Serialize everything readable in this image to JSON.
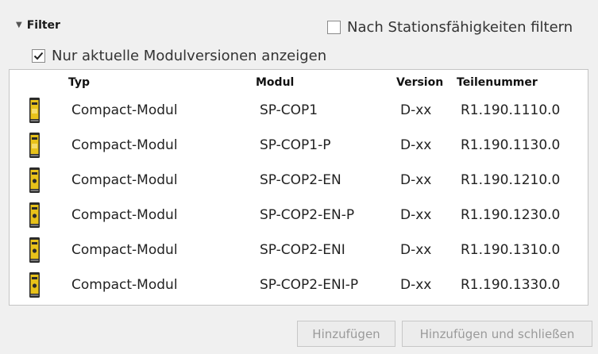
{
  "filter": {
    "label": "Filter",
    "stations_filter": {
      "label": "Nach Stationsfähigkeiten filtern",
      "checked": false
    },
    "current_versions": {
      "label": "Nur aktuelle Modulversionen anzeigen",
      "checked": true
    }
  },
  "table": {
    "columns": {
      "typ": "Typ",
      "modul": "Modul",
      "version": "Version",
      "teilenummer": "Teilenummer"
    },
    "rows": [
      {
        "typ": "Compact-Modul",
        "modul": "SP-COP1",
        "version": "D-xx",
        "teilenummer": "R1.190.1110.0",
        "icon": "compact-module-icon-cop1"
      },
      {
        "typ": "Compact-Modul",
        "modul": "SP-COP1-P",
        "version": "D-xx",
        "teilenummer": "R1.190.1130.0",
        "icon": "compact-module-icon-cop1"
      },
      {
        "typ": "Compact-Modul",
        "modul": "SP-COP2-EN",
        "version": "D-xx",
        "teilenummer": "R1.190.1210.0",
        "icon": "compact-module-icon-cop2"
      },
      {
        "typ": "Compact-Modul",
        "modul": "SP-COP2-EN-P",
        "version": "D-xx",
        "teilenummer": "R1.190.1230.0",
        "icon": "compact-module-icon-cop2"
      },
      {
        "typ": "Compact-Modul",
        "modul": "SP-COP2-ENI",
        "version": "D-xx",
        "teilenummer": "R1.190.1310.0",
        "icon": "compact-module-icon-cop2"
      },
      {
        "typ": "Compact-Modul",
        "modul": "SP-COP2-ENI-P",
        "version": "D-xx",
        "teilenummer": "R1.190.1330.0",
        "icon": "compact-module-icon-cop2"
      }
    ]
  },
  "buttons": {
    "add": "Hinzufügen",
    "add_and_close": "Hinzufügen und schließen"
  },
  "colors": {
    "module_body": "#e8c21a",
    "module_dark": "#2b2b2b"
  }
}
